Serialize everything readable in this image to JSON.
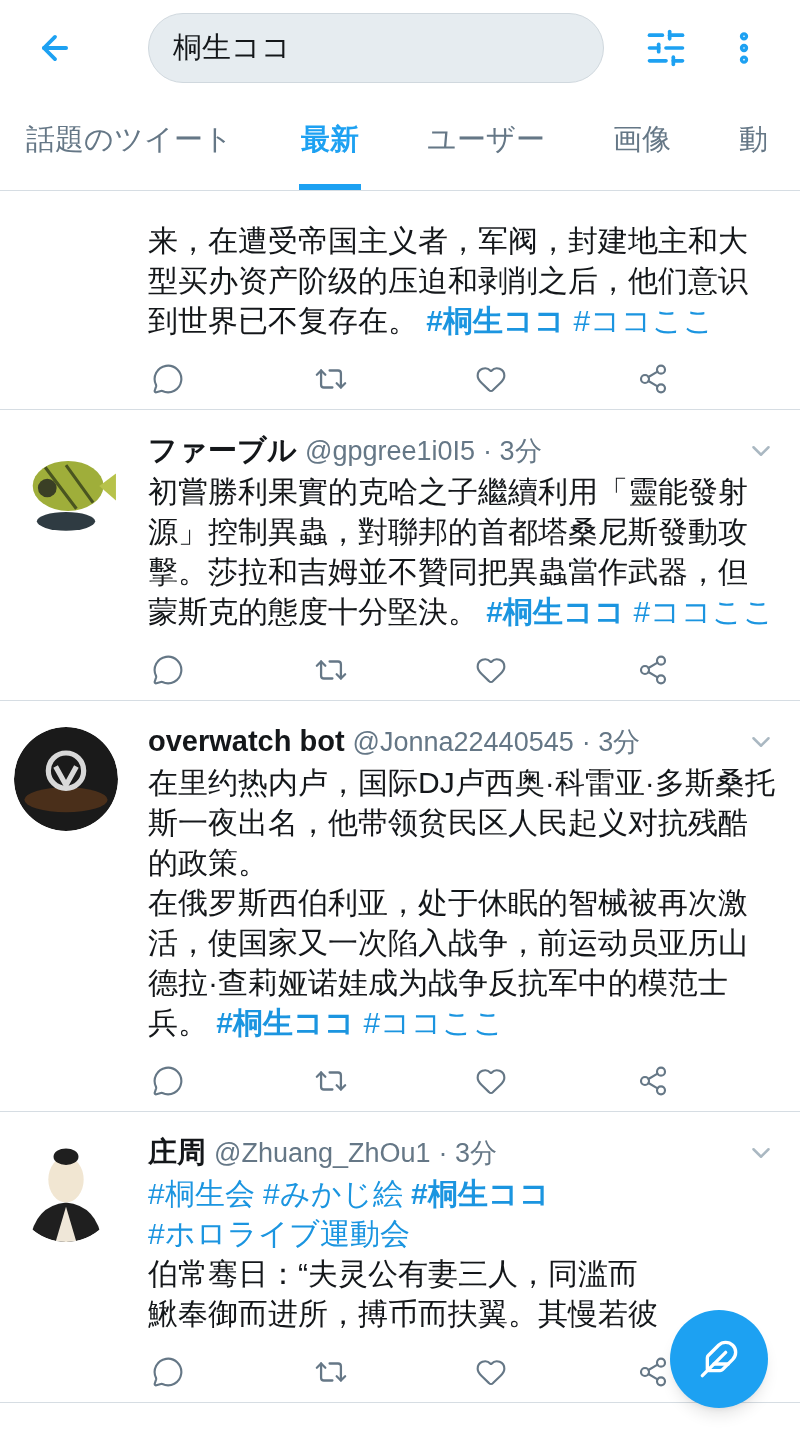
{
  "header": {
    "search": {
      "value": "桐生ココ"
    }
  },
  "tabs": [
    {
      "label": "話題のツイート",
      "selected": false
    },
    {
      "label": "最新",
      "selected": true
    },
    {
      "label": "ユーザー",
      "selected": false
    },
    {
      "label": "画像",
      "selected": false
    },
    {
      "label": "動",
      "selected": false
    }
  ],
  "tweets": [
    {
      "blocks": [
        {
          "text": "来，在遭受帝国主义者，军阀，封建地主和大型买办资产阶级的压迫和剥削之后，他们意识到世界已不复存在。",
          "tags": [
            {
              "text": "#桐生ココ",
              "matched": true
            },
            {
              "text": "#ココここ",
              "matched": false
            }
          ]
        }
      ]
    },
    {
      "name": "ファーブル",
      "handle": "@gpgree1i0I5",
      "time": "· 3分",
      "blocks": [
        {
          "text": "初嘗勝利果實的克哈之子繼續利用「靈能發射源」控制異蟲，對聯邦的首都塔桑尼斯發動攻擊。莎拉和吉姆並不贊同把異蟲當作武器，但蒙斯克的態度十分堅決。",
          "tags": [
            {
              "text": "#桐生ココ",
              "matched": true
            },
            {
              "text": "#ココここ",
              "matched": false
            }
          ]
        }
      ]
    },
    {
      "name": "overwatch bot",
      "handle": "@Jonna22440545",
      "time": "· 3分",
      "blocks": [
        {
          "text": "在里约热内卢，国际DJ卢西奥·科雷亚·多斯桑托斯一夜出名，他带领贫民区人民起义对抗残酷的政策。"
        },
        {
          "text": "在俄罗斯西伯利亚，处于休眠的智械被再次激活，使国家又一次陷入战争，前运动员亚历山德拉·查莉娅诺娃成为战争反抗军中的模范士兵。",
          "tags": [
            {
              "text": "#桐生ココ",
              "matched": true
            },
            {
              "text": "#ココここ",
              "matched": false
            }
          ]
        }
      ]
    },
    {
      "name": "庄周",
      "handle": "@Zhuang_ZhOu1",
      "time": "· 3分",
      "blocks": [
        {
          "tags": [
            {
              "text": "#桐生会",
              "matched": false
            },
            {
              "text": "#みかじ絵",
              "matched": false
            },
            {
              "text": "#桐生ココ",
              "matched": true
            },
            {
              "text": "#ホロライブ運動会",
              "matched": false
            }
          ]
        },
        {
          "text": "伯常骞日：“夫灵公有妻三人，同滥而"
        },
        {
          "text": "鰍奉御而进所，搏币而扶翼。其慢若彼"
        }
      ]
    }
  ]
}
